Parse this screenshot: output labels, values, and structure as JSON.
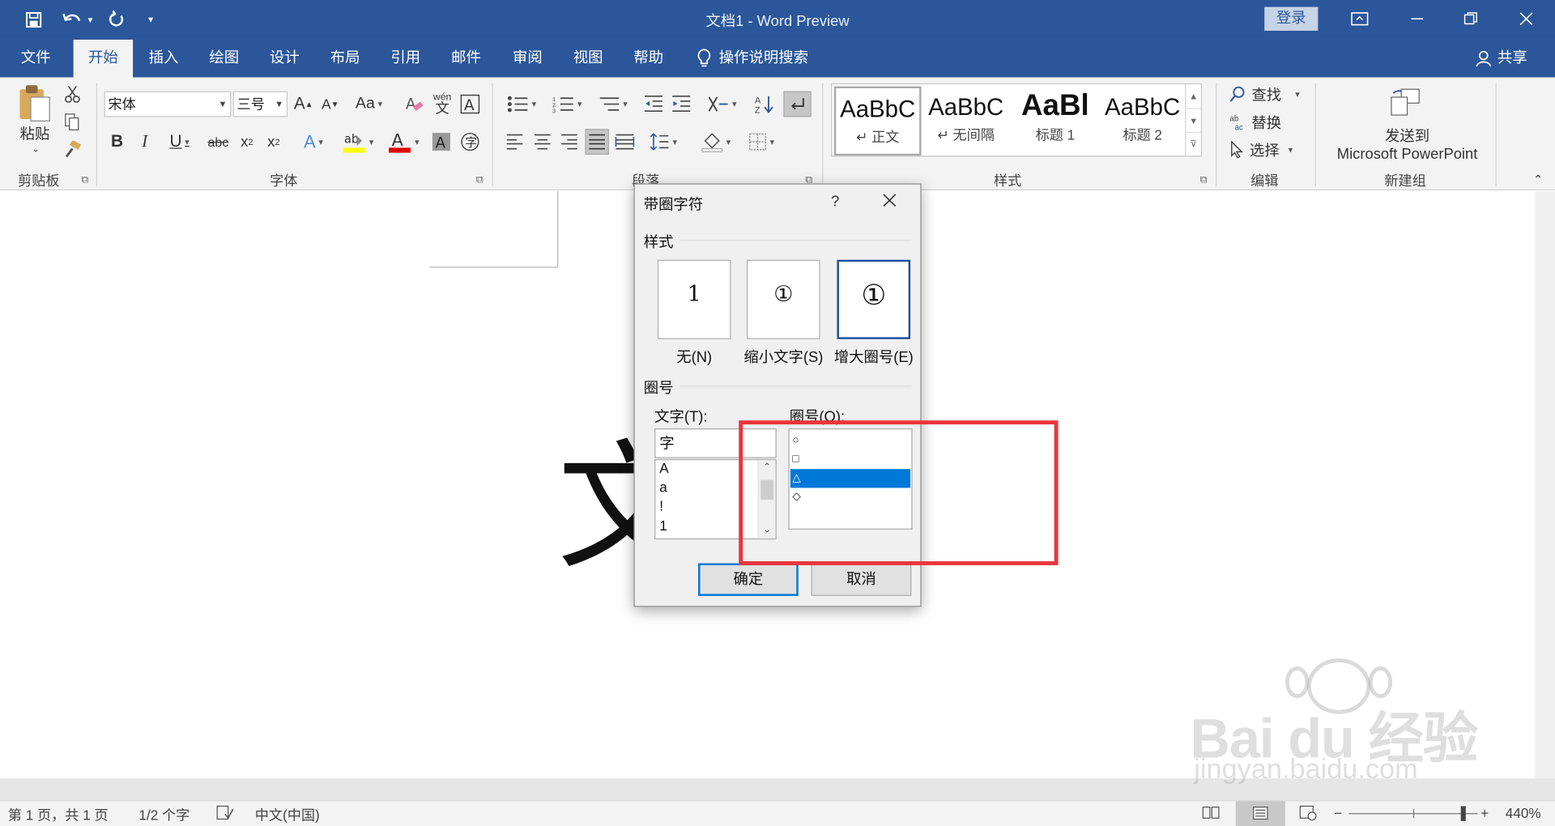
{
  "window": {
    "title": "文档1  -  Word Preview",
    "login": "登录"
  },
  "tabs": [
    {
      "label": "文件"
    },
    {
      "label": "开始"
    },
    {
      "label": "插入"
    },
    {
      "label": "绘图"
    },
    {
      "label": "设计"
    },
    {
      "label": "布局"
    },
    {
      "label": "引用"
    },
    {
      "label": "邮件"
    },
    {
      "label": "审阅"
    },
    {
      "label": "视图"
    },
    {
      "label": "帮助"
    }
  ],
  "tell_me": "操作说明搜索",
  "share": "共享",
  "ribbon": {
    "clipboard": {
      "paste": "粘贴",
      "label": "剪贴板"
    },
    "font": {
      "name": "宋体",
      "size": "三号",
      "label": "字体"
    },
    "paragraph": {
      "label": "段落"
    },
    "styles": {
      "label": "样式",
      "items": [
        {
          "preview": "AaBbC",
          "name": "↵ 正文"
        },
        {
          "preview": "AaBbC",
          "name": "↵ 无间隔"
        },
        {
          "preview": "AaBl",
          "name": "标题 1"
        },
        {
          "preview": "AaBbC",
          "name": "标题 2"
        }
      ]
    },
    "editing": {
      "find": "查找",
      "replace": "替换",
      "select": "选择",
      "label": "编辑"
    },
    "newgroup": {
      "send_line1": "发送到",
      "send_line2": "Microsoft PowerPoint",
      "label": "新建组"
    }
  },
  "document": {
    "glyph": "文"
  },
  "dialog": {
    "title": "带圈字符",
    "help": "?",
    "style_section": "样式",
    "styles": [
      {
        "label": "无(N)",
        "glyph": "1"
      },
      {
        "label": "缩小文字(S)",
        "glyph": "①"
      },
      {
        "label": "增大圈号(E)",
        "glyph": "①"
      }
    ],
    "circle_section": "圈号",
    "text_label": "文字(T):",
    "text_value": "字",
    "text_list": [
      "A",
      "a",
      "!",
      "1"
    ],
    "circle_label": "圈号(O):",
    "circle_list": [
      "○",
      "□",
      "△",
      "◇"
    ],
    "ok": "确定",
    "cancel": "取消"
  },
  "status": {
    "page": "第 1 页，共 1 页",
    "words": "1/2 个字",
    "lang": "中文(中国)",
    "zoom": "440%"
  },
  "watermark": {
    "brand": "Bai du 经验",
    "url": "jingyan.baidu.com"
  },
  "colors": {
    "accent": "#2b579a",
    "highlight": "#e8363b",
    "selection": "#0078d7"
  }
}
